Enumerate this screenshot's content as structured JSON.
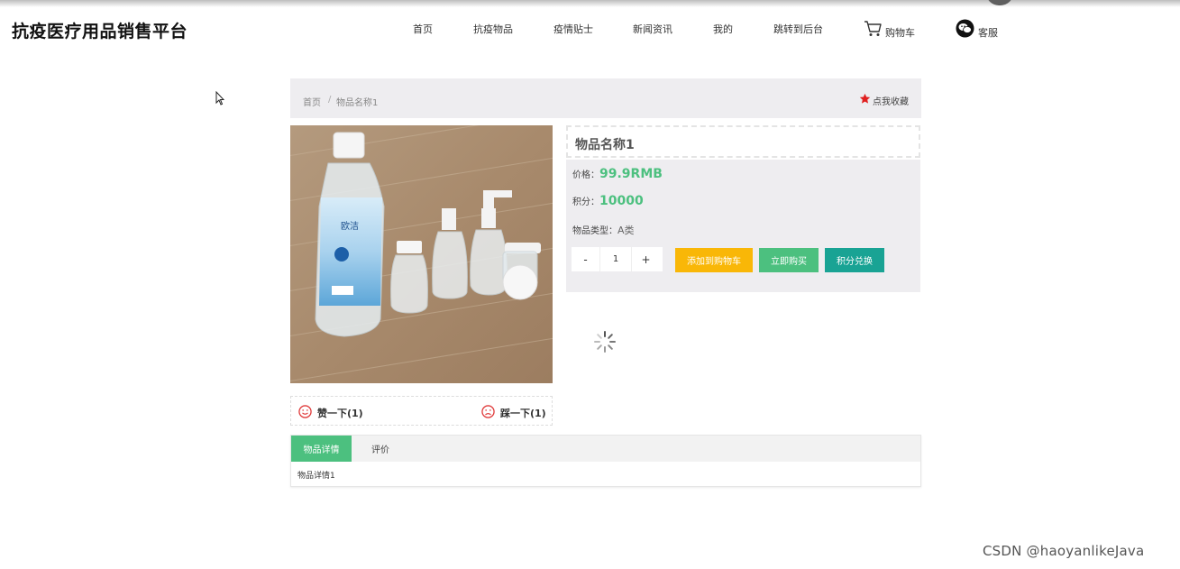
{
  "header": {
    "brand": "抗疫医疗用品销售平台",
    "nav": [
      "首页",
      "抗疫物品",
      "疫情贴士",
      "新闻资讯",
      "我的",
      "跳转到后台"
    ],
    "cart_label": "购物车",
    "service_label": "客服"
  },
  "breadcrumb": {
    "home": "首页",
    "separator": "/",
    "current": "物品名称1",
    "favorite_label": "点我收藏"
  },
  "product": {
    "name": "物品名称1",
    "price_label": "价格：",
    "price_value": "99.9RMB",
    "points_label": "积分：",
    "points_value": "10000",
    "type_label": "物品类型：",
    "type_value": "A类",
    "quantity": "1",
    "minus": "-",
    "plus": "+",
    "add_to_cart": "添加到购物车",
    "buy_now": "立即购买",
    "redeem_points": "积分兑换",
    "colors": {
      "add_to_cart": "#f9b707",
      "buy_now": "#4cc07f",
      "redeem_points": "#19a394",
      "highlight": "#4cc07f"
    }
  },
  "votes": {
    "like": "赞一下(1)",
    "dislike": "踩一下(1)"
  },
  "tabs": {
    "items": [
      "物品详情",
      "评价"
    ],
    "content": "物品详情1"
  },
  "watermark": "CSDN @haoyanlikeJava"
}
